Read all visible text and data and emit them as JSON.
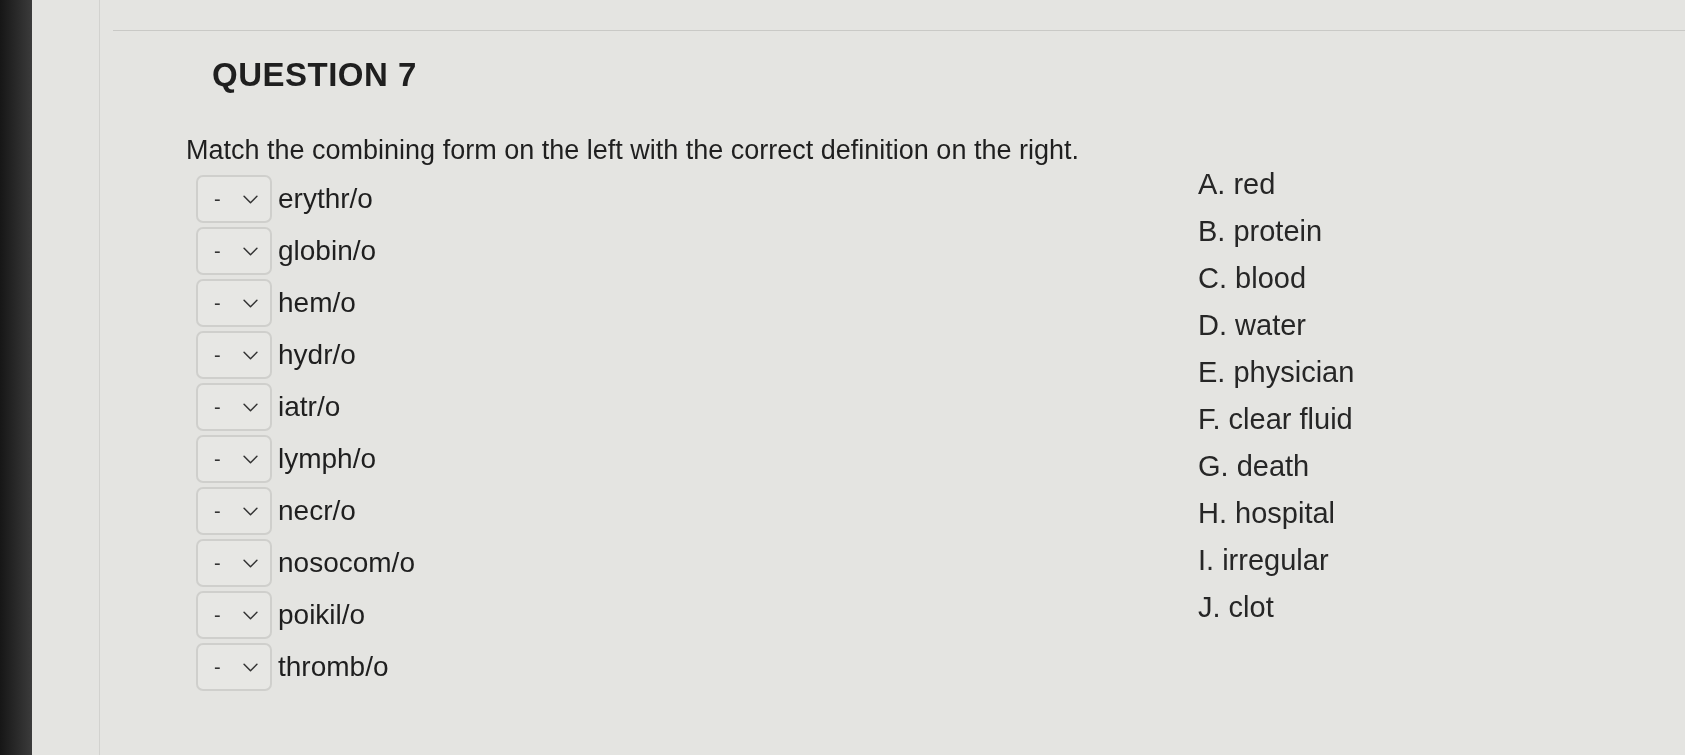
{
  "question": {
    "title": "QUESTION 7",
    "prompt": "Match the combining form on the left with the correct definition on the right."
  },
  "items": [
    {
      "value": "-",
      "term": "erythr/o"
    },
    {
      "value": "-",
      "term": "globin/o"
    },
    {
      "value": "-",
      "term": "hem/o"
    },
    {
      "value": "-",
      "term": "hydr/o"
    },
    {
      "value": "-",
      "term": "iatr/o"
    },
    {
      "value": "-",
      "term": "lymph/o"
    },
    {
      "value": "-",
      "term": "necr/o"
    },
    {
      "value": "-",
      "term": "nosocom/o"
    },
    {
      "value": "-",
      "term": "poikil/o"
    },
    {
      "value": "-",
      "term": "thromb/o"
    }
  ],
  "answers": [
    "A. red",
    "B. protein",
    "C. blood",
    "D. water",
    "E. physician",
    "F. clear fluid",
    "G. death",
    "H. hospital",
    "I. irregular",
    "J. clot"
  ]
}
